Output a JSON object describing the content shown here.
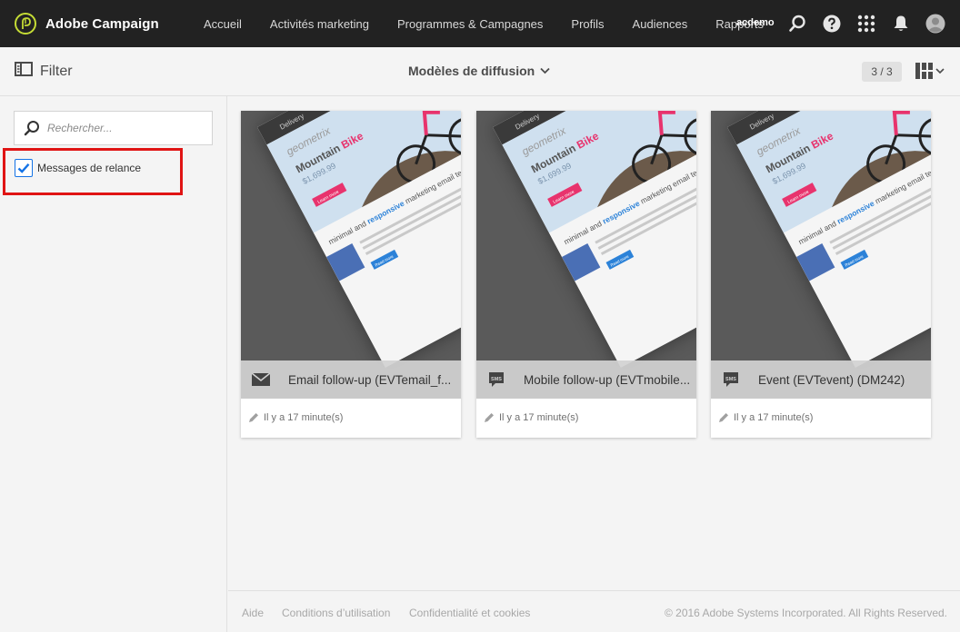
{
  "app": {
    "name": "Adobe Campaign",
    "user": "acdemo"
  },
  "nav": {
    "items": [
      {
        "label": "Accueil"
      },
      {
        "label": "Activités marketing"
      },
      {
        "label": "Programmes & Campagnes"
      },
      {
        "label": "Profils"
      },
      {
        "label": "Audiences"
      },
      {
        "label": "Rapports"
      }
    ]
  },
  "header_icons": [
    "search-icon",
    "help-icon",
    "app-grid-icon",
    "bell-icon",
    "user-avatar-icon"
  ],
  "subheader": {
    "filter_label": "Filter",
    "view_title": "Modèles de diffusion",
    "count": "3 / 3"
  },
  "filter": {
    "search_placeholder": "Rechercher...",
    "option_label": "Messages de relance",
    "option_checked": true
  },
  "cards": [
    {
      "title": "Email follow-up (EVTemail_f...",
      "channel_icon": "envelope-icon",
      "modified": "Il y a 17 minute(s)"
    },
    {
      "title": "Mobile follow-up (EVTmobile...",
      "channel_icon": "sms-icon",
      "modified": "Il y a 17 minute(s)"
    },
    {
      "title": "Event (EVTevent) (DM242)",
      "channel_icon": "sms-icon",
      "modified": "Il y a 17 minute(s)"
    }
  ],
  "thumbnail": {
    "header_tab": "Delivery",
    "brand": "geometrix",
    "headline_word1": "Mountain",
    "headline_word2": "Bike",
    "price": "$1,699.99",
    "cta": "Learn more",
    "section_prefix": "minimal and",
    "section_highlight": "responsive",
    "section_suffix": "marketing email template",
    "body_cta": "Read more"
  },
  "footer": {
    "links": [
      "Aide",
      "Conditions d’utilisation",
      "Confidentialité et cookies"
    ],
    "copyright": "© 2016 Adobe Systems Incorporated. All Rights Reserved."
  },
  "colors": {
    "topbar": "#222222",
    "logo_accent": "#c5dc35",
    "checkbox_accent": "#1473e6",
    "highlight_border": "#e01414",
    "thumb_pink": "#e8336d",
    "thumb_blue": "#2c82d8"
  }
}
